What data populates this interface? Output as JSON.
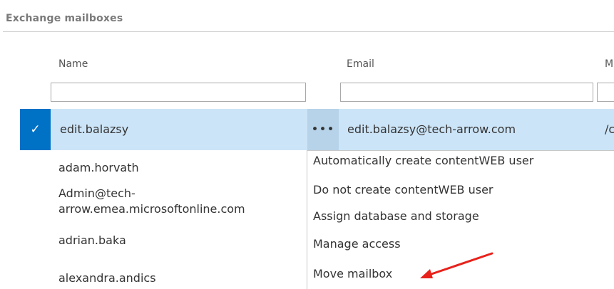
{
  "section": {
    "title": "Exchange mailboxes"
  },
  "columns": {
    "name": "Name",
    "email": "Email",
    "third": "M"
  },
  "filters": {
    "name_value": "",
    "email_value": "",
    "third_value": ""
  },
  "selected_row": {
    "check_glyph": "✓",
    "name": "edit.balazsy",
    "more_glyph": "•••",
    "email": "edit.balazsy@tech-arrow.com",
    "third": "/c"
  },
  "rows": [
    {
      "name": "adam.horvath"
    },
    {
      "name_line1": "Admin@tech-",
      "name_line2": "arrow.emea.microsoftonline.com"
    },
    {
      "name": "adrian.baka"
    },
    {
      "name": "alexandra.andics"
    }
  ],
  "context_menu": {
    "items": [
      "Automatically create contentWEB user",
      "Do not create contentWEB user",
      "Assign database and storage",
      "Manage access",
      "Move mailbox"
    ]
  },
  "colors": {
    "selected_row": "#cce4f7",
    "check_cell": "#0072c6",
    "annotation_arrow": "#e8221b"
  },
  "icons": {
    "check": "checkmark-icon",
    "more": "more-options-icon",
    "annotation": "red-arrow-annotation"
  }
}
